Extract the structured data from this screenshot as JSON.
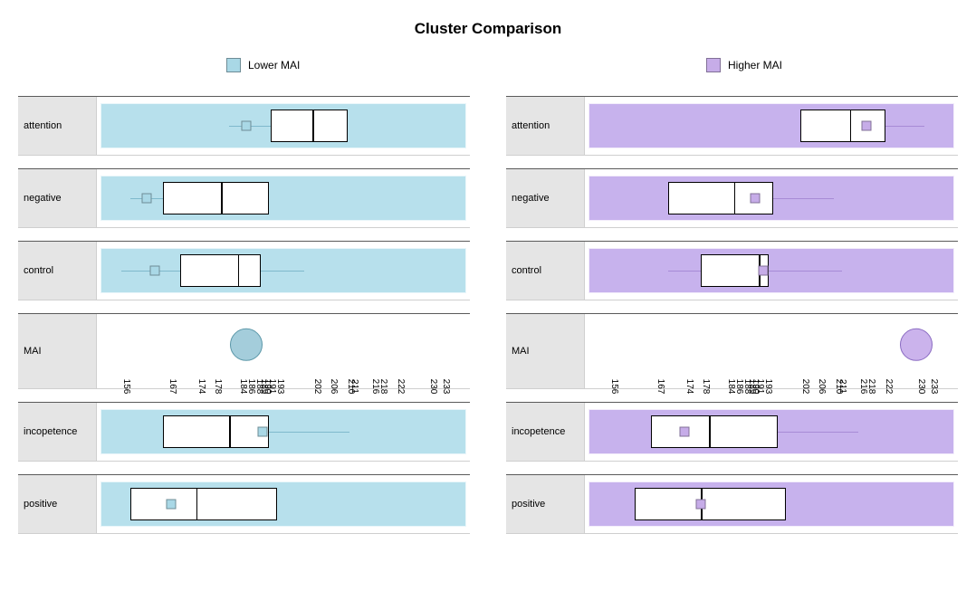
{
  "title": "Cluster Comparison",
  "legend": {
    "lower": {
      "label": "Lower MAI",
      "swatch": "#A9D8E6"
    },
    "higher": {
      "label": "Higher MAI",
      "swatch": "#C6ACE8"
    }
  },
  "colors": {
    "lower_band": "#B7E0EC",
    "lower_band_border": "#E9F6FA",
    "lower_line": "#7FB9CC",
    "lower_mean": "#A9D8E6",
    "lower_circle_fill": "#A4CDDB",
    "lower_circle_stroke": "#5B97A8",
    "higher_band": "#C7B2ED",
    "higher_band_border": "#F3EDFB",
    "higher_line": "#A78BD6",
    "higher_mean": "#C6ACE8",
    "higher_circle_fill": "#CBB3EC",
    "higher_circle_stroke": "#8A6BC2"
  },
  "axis_ticks": [
    156,
    167,
    174,
    178,
    184,
    186,
    188,
    189,
    190,
    191,
    193,
    202,
    206,
    210,
    211,
    216,
    218,
    222,
    230,
    233
  ],
  "axis_range": {
    "min": 150,
    "max": 240
  },
  "chart_data": {
    "type": "box",
    "title": "Cluster Comparison",
    "x_range": [
      150,
      240
    ],
    "series": [
      {
        "name": "Lower MAI",
        "color": "#A9D8E6",
        "measures": [
          {
            "label": "attention",
            "whisker_lo": 182,
            "q1": 192,
            "median": 202,
            "q3": 210,
            "whisker_hi": 210,
            "mean": 186
          },
          {
            "label": "negative",
            "whisker_lo": 158,
            "q1": 166,
            "median": 180,
            "q3": 191,
            "whisker_hi": 191,
            "mean": 162
          },
          {
            "label": "control",
            "whisker_lo": 156,
            "q1": 170,
            "median": 184,
            "q3": 189,
            "whisker_hi": 200,
            "mean": 164
          },
          {
            "label": "MAI",
            "point": 186
          },
          {
            "label": "incopetence",
            "whisker_lo": 166,
            "q1": 166,
            "median": 182,
            "q3": 191,
            "whisker_hi": 211,
            "mean": 190
          },
          {
            "label": "positive",
            "whisker_lo": 158,
            "q1": 158,
            "median": 174,
            "q3": 193,
            "whisker_hi": 193,
            "mean": 168
          }
        ]
      },
      {
        "name": "Higher MAI",
        "color": "#C6ACE8",
        "measures": [
          {
            "label": "attention",
            "whisker_lo": 202,
            "q1": 202,
            "median": 214,
            "q3": 222,
            "whisker_hi": 232,
            "mean": 218
          },
          {
            "label": "negative",
            "whisker_lo": 170,
            "q1": 170,
            "median": 186,
            "q3": 195,
            "whisker_hi": 210,
            "mean": 191
          },
          {
            "label": "control",
            "whisker_lo": 170,
            "q1": 178,
            "median": 192,
            "q3": 194,
            "whisker_hi": 212,
            "mean": 193
          },
          {
            "label": "MAI",
            "point": 230
          },
          {
            "label": "incopetence",
            "whisker_lo": 166,
            "q1": 166,
            "median": 180,
            "q3": 196,
            "whisker_hi": 216,
            "mean": 174
          },
          {
            "label": "positive",
            "whisker_lo": 162,
            "q1": 162,
            "median": 178,
            "q3": 198,
            "whisker_hi": 198,
            "mean": 178
          }
        ]
      }
    ]
  }
}
